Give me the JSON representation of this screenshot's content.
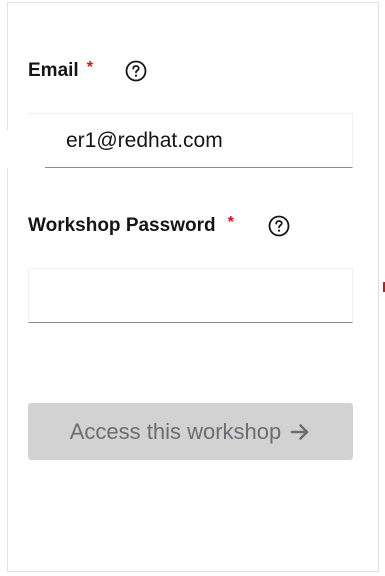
{
  "form": {
    "email": {
      "label": "Email",
      "required_mark": "*",
      "value": "er1@redhat.com",
      "placeholder": ""
    },
    "password": {
      "label": "Workshop Password",
      "required_mark": "*",
      "value": "",
      "placeholder": ""
    },
    "submit": {
      "label": "Access this workshop",
      "icon": "arrow-right-icon",
      "disabled": true
    }
  },
  "colors": {
    "required": "#c9190b",
    "label": "#151515",
    "button_bg_disabled": "#d2d2d2",
    "button_text_disabled": "#6a6e73",
    "input_border_bottom": "#8a8d90"
  },
  "icons": {
    "help": "help-circle-icon"
  }
}
